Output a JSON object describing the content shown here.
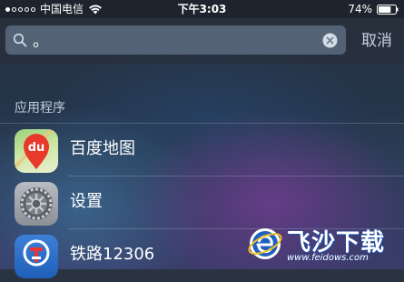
{
  "status_bar": {
    "carrier": "中国电信",
    "time": "下午3:03",
    "battery_percent": "74%",
    "battery_level": 0.74,
    "signal_bars_filled": 1,
    "signal_bars_total": 5,
    "icons": [
      "signal-dots-icon",
      "wifi-icon",
      "battery-icon"
    ]
  },
  "search": {
    "query": "。",
    "cancel_label": "取消",
    "icons": [
      "search-icon",
      "clear-icon"
    ]
  },
  "section": {
    "title": "应用程序"
  },
  "apps": [
    {
      "label": "百度地图",
      "icon": "baidu-maps-icon",
      "icon_text": "du"
    },
    {
      "label": "设置",
      "icon": "settings-gear-icon"
    },
    {
      "label": "铁路12306",
      "icon": "railway-12306-icon"
    }
  ],
  "watermark": {
    "text": "飞沙下载",
    "url": "www.feidows.com",
    "icon": "ie-logo-icon"
  },
  "colors": {
    "search_field_bg": "#7b8ca5",
    "cancel_text": "#c8d2e2",
    "baidu_pin": "#e8392b",
    "railway_blue": "#2a6cc8"
  }
}
